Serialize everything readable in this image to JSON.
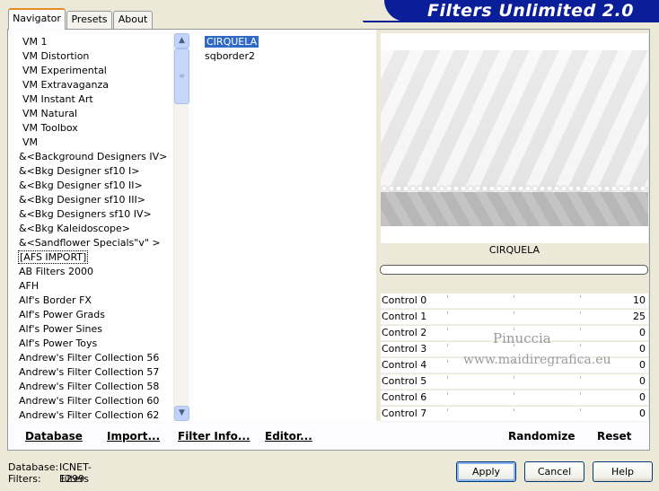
{
  "tabs": [
    "Navigator",
    "Presets",
    "About"
  ],
  "banner": "Filters Unlimited 2.0",
  "categories": [
    "VM 1",
    "VM Distortion",
    "VM Experimental",
    "VM Extravaganza",
    "VM Instant Art",
    "VM Natural",
    "VM Toolbox",
    "VM",
    "&<Background Designers IV>",
    "&<Bkg Designer sf10 I>",
    "&<Bkg Designer sf10 II>",
    "&<Bkg Designer sf10 III>",
    "&<Bkg Designers sf10 IV>",
    "&<Bkg Kaleidoscope>",
    "&<Sandflower Specials\"v\" >",
    "[AFS IMPORT]",
    "AB Filters 2000",
    "AFH",
    "Alf's Border FX",
    "Alf's Power Grads",
    "Alf's Power Sines",
    "Alf's Power Toys",
    "Andrew's Filter Collection 56",
    "Andrew's Filter Collection 57",
    "Andrew's Filter Collection 58",
    "Andrew's Filter Collection 60",
    "Andrew's Filter Collection 62"
  ],
  "filters": [
    "CIRQUELA",
    "sqborder2"
  ],
  "filter_title": "CIRQUELA",
  "controls": [
    {
      "label": "Control 0",
      "value": "10"
    },
    {
      "label": "Control 1",
      "value": "25"
    },
    {
      "label": "Control 2",
      "value": "0"
    },
    {
      "label": "Control 3",
      "value": "0"
    },
    {
      "label": "Control 4",
      "value": "0"
    },
    {
      "label": "Control 5",
      "value": "0"
    },
    {
      "label": "Control 6",
      "value": "0"
    },
    {
      "label": "Control 7",
      "value": "0"
    }
  ],
  "watermark": {
    "line1": "Pinuccia",
    "line2": "www.maidiregrafica.eu"
  },
  "bottom_links": {
    "database": "Database",
    "import": "Import...",
    "filter_info": "Filter Info...",
    "editor": "Editor...",
    "randomize": "Randomize",
    "reset": "Reset"
  },
  "buttons": {
    "apply": "Apply",
    "cancel": "Cancel",
    "help": "Help"
  },
  "status": {
    "database_label": "Database:",
    "database_value": "ICNET-Filters",
    "filters_label": "Filters:",
    "filters_value": "1299"
  },
  "colors": {
    "banner": "#0b1e9a",
    "selection": "#316ac5",
    "tab_accent": "#e68b2c"
  }
}
